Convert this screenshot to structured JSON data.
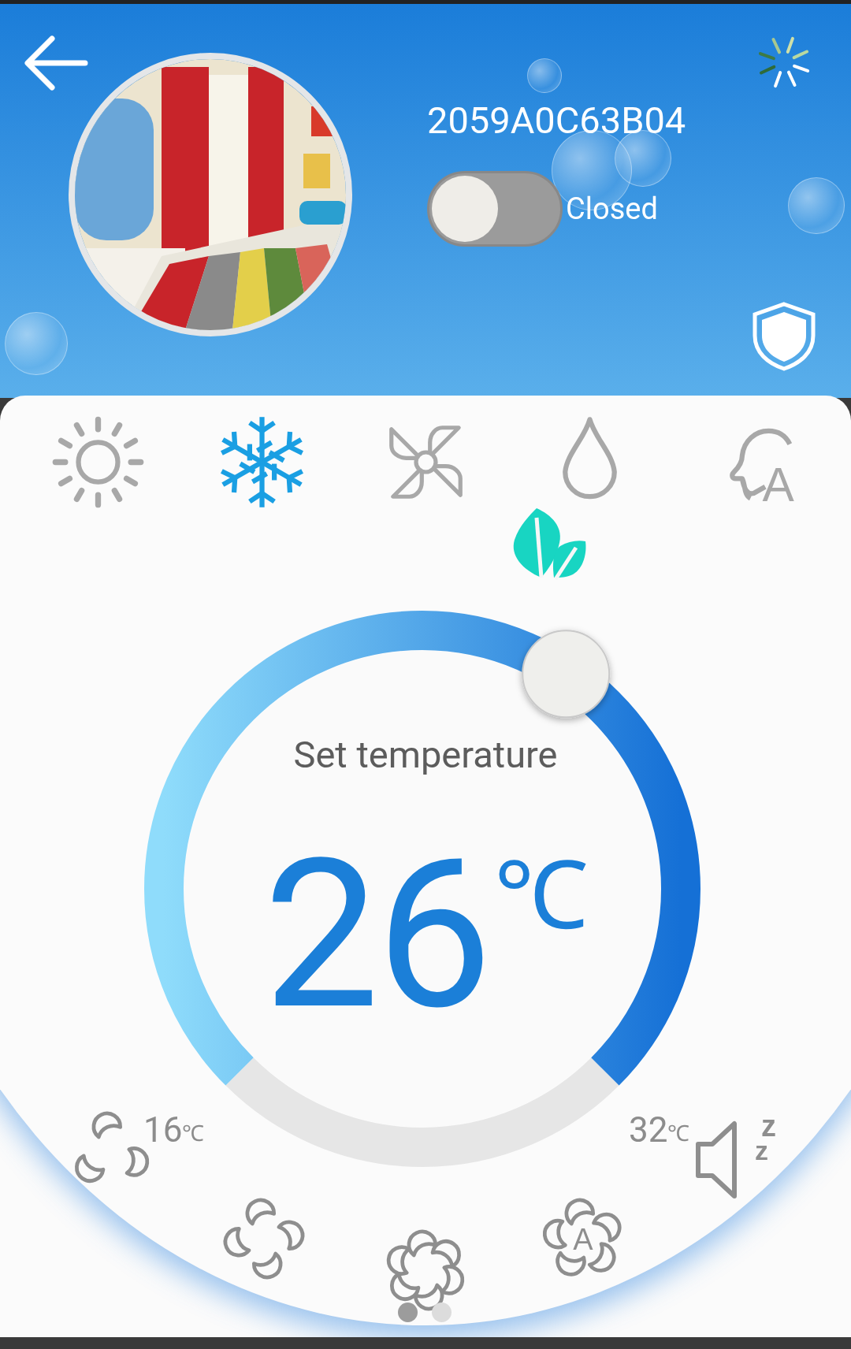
{
  "header": {
    "device_name": "2059A0C63B04",
    "power": {
      "on": false,
      "label": "Closed"
    }
  },
  "modes": [
    {
      "kind": "heat",
      "selected": false
    },
    {
      "kind": "cool",
      "selected": true
    },
    {
      "kind": "fan",
      "selected": false
    },
    {
      "kind": "dry",
      "selected": false
    },
    {
      "kind": "auto",
      "selected": false,
      "letter": "A"
    }
  ],
  "eco": {
    "on": true
  },
  "thermostat": {
    "label": "Set temperature",
    "value": "26",
    "unit": "℃",
    "min": "16",
    "min_unit": "℃",
    "max": "32",
    "max_unit": "℃"
  },
  "fan_speeds": [
    {
      "kind": "low",
      "selected": false
    },
    {
      "kind": "medium",
      "selected": false
    },
    {
      "kind": "high",
      "selected": false
    },
    {
      "kind": "auto",
      "selected": false,
      "letter": "A"
    }
  ],
  "sleep": {
    "on": false,
    "marks": [
      "z",
      "z"
    ]
  },
  "pager": [
    {
      "selected": true
    },
    {
      "selected": false
    }
  ]
}
